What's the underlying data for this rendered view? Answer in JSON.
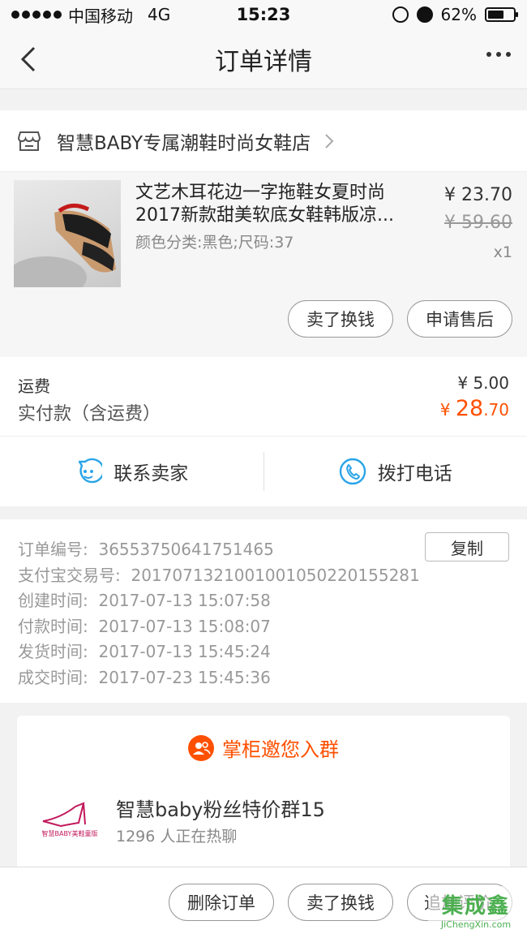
{
  "status_bar": {
    "carrier": "中国移动",
    "network": "4G",
    "time": "15:23",
    "battery": "62%",
    "battery_level": 0.62
  },
  "nav": {
    "title": "订单详情"
  },
  "shop": {
    "name": "智慧BABY专属潮鞋时尚女鞋店"
  },
  "product": {
    "title_line1": "文艺木耳花边一字拖鞋女夏时尚",
    "title_line2": "2017新款甜美软底女鞋韩版凉...",
    "spec": "颜色分类:黑色;尺码:37",
    "price": "¥ 23.70",
    "original_price": "¥ 59.60",
    "quantity": "x1",
    "actions": [
      "卖了换钱",
      "申请售后"
    ]
  },
  "fees": {
    "shipping_label": "运费",
    "shipping_value": "¥ 5.00",
    "paid_label": "实付款（含运费）",
    "paid_currency": "¥ ",
    "paid_integer": "28",
    "paid_decimal": ".70"
  },
  "contact": {
    "seller": "联系卖家",
    "phone": "拨打电话"
  },
  "order_info": {
    "copy_label": "复制",
    "rows": [
      {
        "label": "订单编号:",
        "value": "36553750641751465"
      },
      {
        "label": "支付宝交易号:",
        "value": "2017071321001001050220155281"
      },
      {
        "label": "创建时间:",
        "value": "2017-07-13 15:07:58"
      },
      {
        "label": "付款时间:",
        "value": "2017-07-13 15:08:07"
      },
      {
        "label": "发货时间:",
        "value": "2017-07-13 15:45:24"
      },
      {
        "label": "成交时间:",
        "value": "2017-07-23 15:45:36"
      }
    ]
  },
  "group": {
    "header": "掌柜邀您入群",
    "name": "智慧baby粉丝特价群15",
    "count": "1296 人正在热聊",
    "logo_text": "智慧BABY美鞋童版"
  },
  "bottom_actions": [
    "删除订单",
    "卖了换钱",
    "追加评价"
  ],
  "watermark": {
    "top": "集成鑫",
    "bottom": "JiChengXin.com"
  },
  "colors": {
    "accent": "#ff5000",
    "contact_icon": "#2aa4e8",
    "watermark": "#4caf50"
  }
}
